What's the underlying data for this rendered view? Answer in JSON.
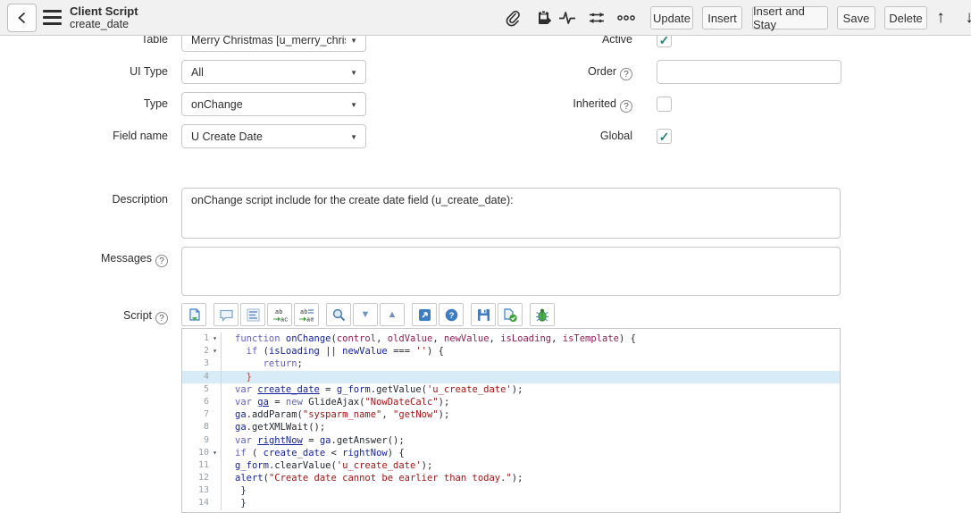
{
  "header": {
    "title": "Client Script",
    "subtitle": "create_date",
    "icons": [
      "attachment-icon",
      "clipboard-icon",
      "activity-stream-icon",
      "personalize-form-icon",
      "more-options-icon"
    ],
    "buttons": [
      {
        "label": "Update"
      },
      {
        "label": "Insert"
      },
      {
        "label": "Insert and Stay"
      },
      {
        "label": "Save"
      },
      {
        "label": "Delete"
      }
    ],
    "nav_icons": [
      "up-arrow-icon",
      "down-arrow-icon"
    ]
  },
  "form": {
    "rows_left": [
      {
        "label": "Table",
        "type": "select",
        "value": "Merry Christmas [u_merry_christ...",
        "help": false
      },
      {
        "label": "UI Type",
        "type": "select",
        "value": "All",
        "help": false
      },
      {
        "label": "Type",
        "type": "select",
        "value": "onChange",
        "help": false
      },
      {
        "label": "Field name",
        "type": "select",
        "value": "U Create Date",
        "help": false
      }
    ],
    "rows_right": [
      {
        "label": "Active",
        "type": "checkbox",
        "checked": true,
        "help": false
      },
      {
        "label": "Order",
        "type": "text",
        "value": "",
        "help": true
      },
      {
        "label": "Inherited",
        "type": "checkbox",
        "checked": false,
        "help": true
      },
      {
        "label": "Global",
        "type": "checkbox",
        "checked": true,
        "help": false
      }
    ],
    "description": {
      "label": "Description",
      "value": "onChange script include for the create date field (u_create_date):",
      "help": false
    },
    "messages": {
      "label": "Messages",
      "value": "",
      "help": true
    },
    "script": {
      "label": "Script",
      "help": true
    }
  },
  "script_editor": {
    "toolbar_groups": [
      [
        "syntax-editor-toggle-icon"
      ],
      [
        "comment-icon",
        "format-code-icon",
        "replace-icon",
        "replace-all-icon"
      ],
      [
        "search-icon",
        "find-next-icon",
        "find-previous-icon"
      ],
      [
        "open-in-new-window-icon",
        "help-icon"
      ],
      [
        "save-script-icon",
        "syntax-check-icon"
      ],
      [
        "debug-icon"
      ]
    ],
    "active_line": 4,
    "lines": [
      {
        "n": 1,
        "fold": true,
        "tokens": [
          [
            "k",
            "function"
          ],
          [
            "p",
            " "
          ],
          [
            "v",
            "onChange"
          ],
          [
            "p",
            "("
          ],
          [
            "a",
            "control"
          ],
          [
            "p",
            ", "
          ],
          [
            "a",
            "oldValue"
          ],
          [
            "p",
            ", "
          ],
          [
            "a",
            "newValue"
          ],
          [
            "p",
            ", "
          ],
          [
            "a",
            "isLoading"
          ],
          [
            "p",
            ", "
          ],
          [
            "a",
            "isTemplate"
          ],
          [
            "p",
            ") {"
          ]
        ]
      },
      {
        "n": 2,
        "fold": true,
        "tokens": [
          [
            "p",
            "  "
          ],
          [
            "k",
            "if"
          ],
          [
            "p",
            " ("
          ],
          [
            "v",
            "isLoading"
          ],
          [
            "p",
            " || "
          ],
          [
            "v",
            "newValue"
          ],
          [
            "p",
            " === "
          ],
          [
            "s",
            "''"
          ],
          [
            "p",
            ") {"
          ]
        ]
      },
      {
        "n": 3,
        "fold": false,
        "tokens": [
          [
            "p",
            "     "
          ],
          [
            "k",
            "return"
          ],
          [
            "p",
            ";"
          ]
        ]
      },
      {
        "n": 4,
        "fold": false,
        "tokens": [
          [
            "p",
            "  "
          ],
          [
            "r",
            "}"
          ]
        ]
      },
      {
        "n": 5,
        "fold": false,
        "tokens": [
          [
            "k",
            "var"
          ],
          [
            "p",
            " "
          ],
          [
            "d",
            "create_date"
          ],
          [
            "p",
            " = "
          ],
          [
            "v",
            "g_form"
          ],
          [
            "p",
            ".getValue("
          ],
          [
            "s",
            "'u_create_date'"
          ],
          [
            "p",
            ");"
          ]
        ]
      },
      {
        "n": 6,
        "fold": false,
        "tokens": [
          [
            "k",
            "var"
          ],
          [
            "p",
            " "
          ],
          [
            "d",
            "ga"
          ],
          [
            "p",
            " = "
          ],
          [
            "k",
            "new"
          ],
          [
            "p",
            " GlideAjax("
          ],
          [
            "s",
            "\"NowDateCalc\""
          ],
          [
            "p",
            ");"
          ]
        ]
      },
      {
        "n": 7,
        "fold": false,
        "tokens": [
          [
            "v",
            "ga"
          ],
          [
            "p",
            ".addParam("
          ],
          [
            "s",
            "\"sysparm_name\""
          ],
          [
            "p",
            ", "
          ],
          [
            "s",
            "\"getNow\""
          ],
          [
            "p",
            ");"
          ]
        ]
      },
      {
        "n": 8,
        "fold": false,
        "tokens": [
          [
            "v",
            "ga"
          ],
          [
            "p",
            ".getXMLWait();"
          ]
        ]
      },
      {
        "n": 9,
        "fold": false,
        "tokens": [
          [
            "k",
            "var"
          ],
          [
            "p",
            " "
          ],
          [
            "d",
            "rightNow"
          ],
          [
            "p",
            " = "
          ],
          [
            "v",
            "ga"
          ],
          [
            "p",
            ".getAnswer();"
          ]
        ]
      },
      {
        "n": 10,
        "fold": true,
        "tokens": [
          [
            "k",
            "if"
          ],
          [
            "p",
            " ( "
          ],
          [
            "v",
            "create_date"
          ],
          [
            "p",
            " < "
          ],
          [
            "v",
            "rightNow"
          ],
          [
            "p",
            ") {"
          ]
        ]
      },
      {
        "n": 11,
        "fold": false,
        "tokens": [
          [
            "v",
            "g_form"
          ],
          [
            "p",
            ".clearValue("
          ],
          [
            "s",
            "'u_create_date'"
          ],
          [
            "p",
            ");"
          ]
        ]
      },
      {
        "n": 12,
        "fold": false,
        "tokens": [
          [
            "v",
            "alert"
          ],
          [
            "p",
            "("
          ],
          [
            "s",
            "\"Create date cannot be earlier than today.\""
          ],
          [
            "p",
            ");"
          ]
        ]
      },
      {
        "n": 13,
        "fold": false,
        "tokens": [
          [
            "p",
            " }"
          ]
        ]
      },
      {
        "n": 14,
        "fold": false,
        "tokens": [
          [
            "p",
            " }"
          ]
        ]
      }
    ]
  },
  "colors": {
    "header_bg": "#f1f1f1",
    "accent_teal": "#2b8073",
    "active_line_bg": "#d8ecf8",
    "keyword": "#6262c6",
    "string": "#a31515",
    "variable": "#14239d",
    "param": "#8b2252"
  }
}
